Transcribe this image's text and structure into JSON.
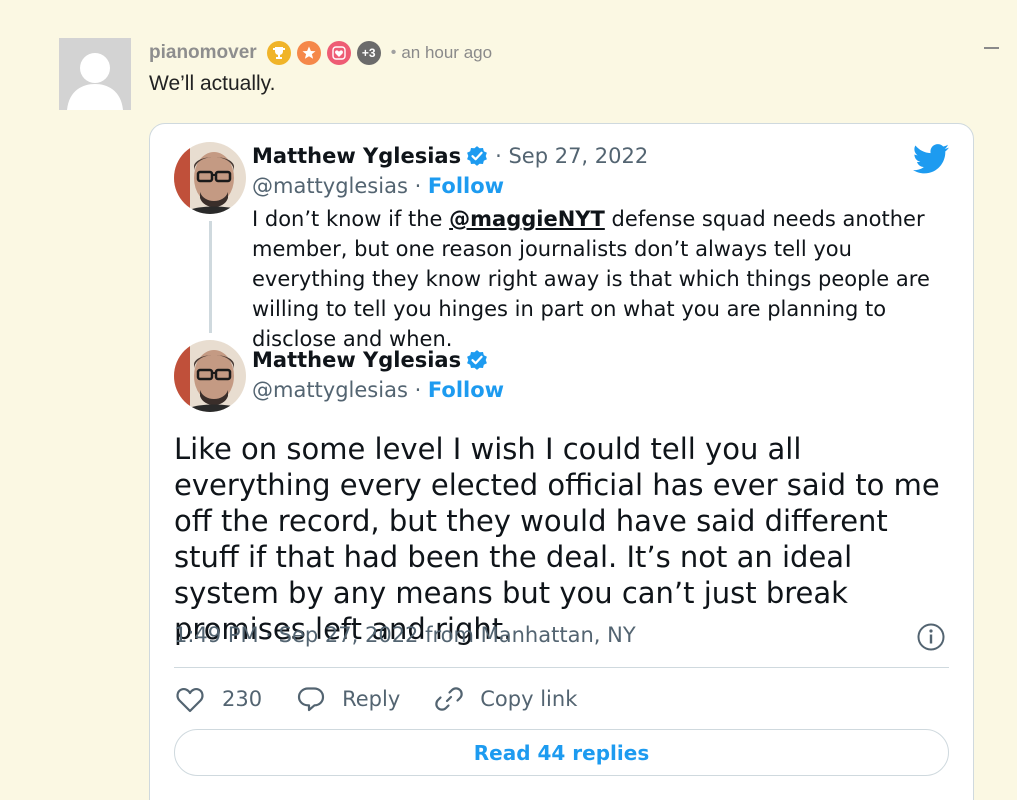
{
  "comment": {
    "username": "pianomover",
    "badges": [
      {
        "icon": "trophy-icon",
        "color": "#f0b429"
      },
      {
        "icon": "star-icon",
        "color": "#f5884a"
      },
      {
        "icon": "heart-icon",
        "color": "#ee5c74"
      }
    ],
    "extra_badges": "+3",
    "separator": "•",
    "time": "an hour ago",
    "text": "We’ll actually."
  },
  "tweet": {
    "reply_to": {
      "name": "Matthew Yglesias",
      "date": "· Sep 27, 2022",
      "handle": "@mattyglesias",
      "handle_sep": " · ",
      "follow": "Follow",
      "text_before": "I don’t know if the ",
      "mention": "@maggieNYT",
      "text_after": " defense squad needs another member, but one reason journalists don’t always tell you everything they know right away is that which things people are willing to tell you hinges in part on what you are planning to disclose and when."
    },
    "main": {
      "name": "Matthew Yglesias",
      "handle": "@mattyglesias",
      "handle_sep": " · ",
      "follow": "Follow",
      "text": "Like on some level I wish I could tell you all everything every elected official has ever said to me off the record, but they would have said different stuff if that had been the deal. It’s not an ideal system by any means but you can’t just break promises left and right.",
      "meta": "1:49 PM · Sep 27, 2022 from Manhattan, NY",
      "likes": "230",
      "reply_label": "Reply",
      "copy_link_label": "Copy link",
      "read_replies": "Read 44 replies"
    },
    "colors": {
      "accent": "#1d9bf0",
      "secondary_text": "#536471",
      "border": "#cfd9de"
    }
  }
}
